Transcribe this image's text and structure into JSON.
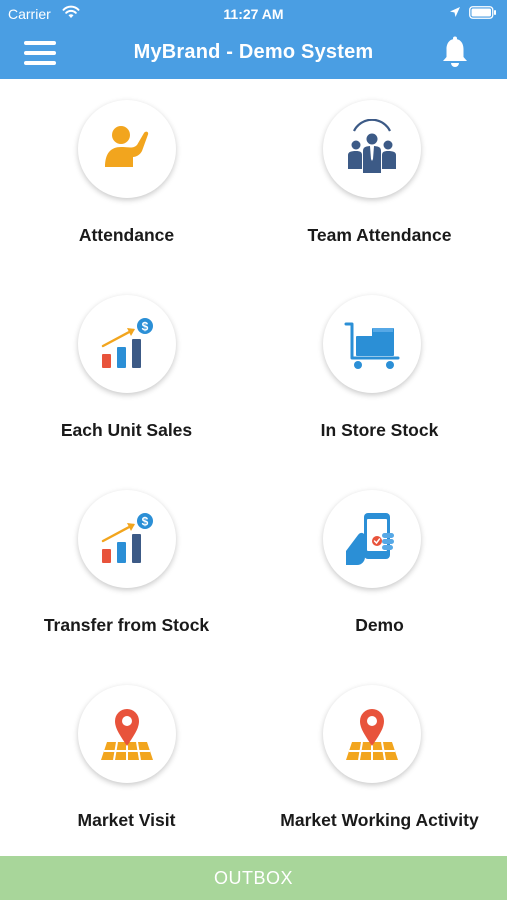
{
  "status_bar": {
    "carrier": "Carrier",
    "time": "11:27 AM"
  },
  "nav": {
    "title": "MyBrand - Demo System",
    "menu_icon": "hamburger-menu-icon",
    "notification_icon": "bell-icon"
  },
  "colors": {
    "header": "#4a9ee3",
    "outbox": "#a8d69a",
    "icon_blue": "#2b8fd6",
    "icon_orange": "#f2a51e",
    "icon_red": "#e8533b",
    "icon_navy": "#3c5a86"
  },
  "menu": [
    {
      "label": "Attendance",
      "icon": "person-raising-hand-icon"
    },
    {
      "label": "Team Attendance",
      "icon": "team-group-icon"
    },
    {
      "label": "Each Unit Sales",
      "icon": "sales-growth-chart-icon"
    },
    {
      "label": "In Store Stock",
      "icon": "stock-cart-icon"
    },
    {
      "label": "Transfer from Stock",
      "icon": "sales-growth-chart-icon"
    },
    {
      "label": "Demo",
      "icon": "hand-holding-phone-icon"
    },
    {
      "label": "Market Visit",
      "icon": "map-location-pin-icon"
    },
    {
      "label": "Market Working Activity",
      "icon": "map-location-pin-icon"
    }
  ],
  "outbox": {
    "label": "OUTBOX"
  }
}
